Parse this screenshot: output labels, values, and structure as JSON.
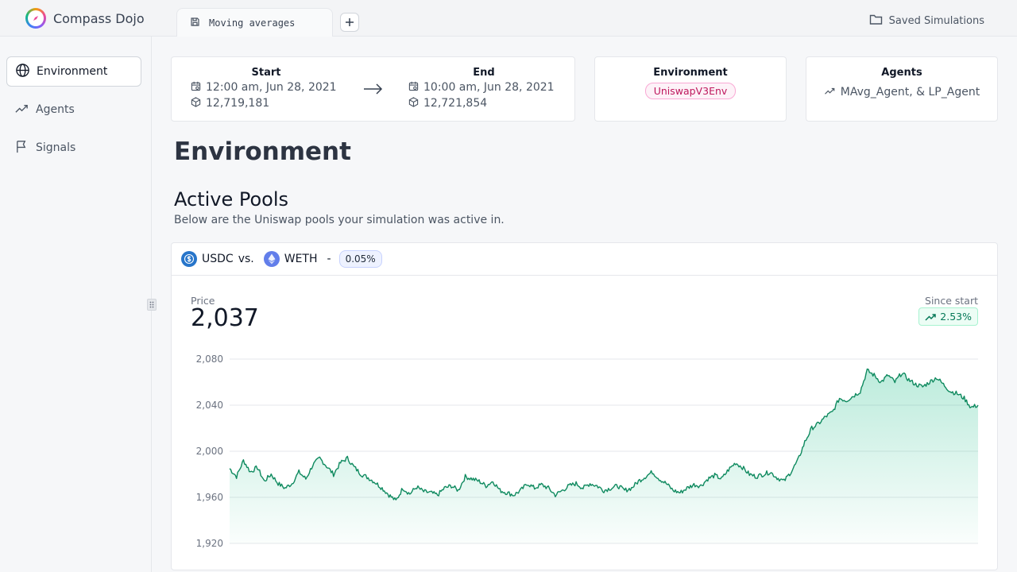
{
  "app": {
    "name": "Compass Dojo"
  },
  "tabs": [
    {
      "label": "Moving averages"
    }
  ],
  "header": {
    "saved_label": "Saved Simulations"
  },
  "sidebar": {
    "items": [
      {
        "label": "Environment",
        "icon": "globe-icon",
        "active": true
      },
      {
        "label": "Agents",
        "icon": "trend-icon",
        "active": false
      },
      {
        "label": "Signals",
        "icon": "flag-icon",
        "active": false
      }
    ]
  },
  "summary": {
    "start": {
      "title": "Start",
      "time": "12:00 am, Jun 28, 2021",
      "block": "12,719,181"
    },
    "end": {
      "title": "End",
      "time": "10:00 am, Jun 28, 2021",
      "block": "12,721,854"
    },
    "environment": {
      "title": "Environment",
      "value": "UniswapV3Env"
    },
    "agents": {
      "title": "Agents",
      "value": "MAvg_Agent, & LP_Agent"
    }
  },
  "page": {
    "title": "Environment",
    "section_title": "Active Pools",
    "section_subtitle": "Below are the Uniswap pools your simulation was active in."
  },
  "pool": {
    "token0": "USDC",
    "vs": "vs.",
    "token1": "WETH",
    "dash": "-",
    "fee": "0.05%",
    "price_label": "Price",
    "price_value": "2,037",
    "since_label": "Since start",
    "since_value": "2.53%"
  },
  "colors": {
    "accent": "#0f8a5f",
    "fill": "#10b981"
  },
  "chart_data": {
    "type": "area",
    "title": "",
    "xlabel": "",
    "ylabel": "",
    "ylim": [
      1920,
      2080
    ],
    "yticks": [
      2080,
      2040,
      2000,
      1960,
      1920
    ],
    "ytick_labels": [
      "2,080",
      "2,040",
      "2,000",
      "1,960",
      "1,920"
    ],
    "grid": true,
    "series": [
      {
        "values": [
          1985,
          1978,
          1992,
          1982,
          1986,
          1974,
          1980,
          1972,
          1968,
          1972,
          1982,
          1976,
          1988,
          1994,
          1987,
          1980,
          1990,
          1994,
          1986,
          1980,
          1977,
          1973,
          1968,
          1962,
          1957,
          1968,
          1963,
          1969,
          1965,
          1964,
          1962,
          1968,
          1970,
          1966,
          1978,
          1976,
          1974,
          1970,
          1974,
          1966,
          1964,
          1962,
          1966,
          1972,
          1968,
          1971,
          1968,
          1962,
          1966,
          1970,
          1972,
          1968,
          1972,
          1970,
          1966,
          1968,
          1970,
          1966,
          1968,
          1974,
          1978,
          1982,
          1976,
          1972,
          1966,
          1964,
          1968,
          1971,
          1970,
          1976,
          1979,
          1976,
          1984,
          1990,
          1986,
          1980,
          1978,
          1980,
          1982,
          1977,
          1974,
          1982,
          1992,
          2008,
          2020,
          2024,
          2030,
          2034,
          2046,
          2044,
          2048,
          2052,
          2070,
          2066,
          2060,
          2066,
          2060,
          2068,
          2062,
          2058,
          2056,
          2060,
          2064,
          2058,
          2052,
          2050,
          2046,
          2038,
          2040
        ]
      }
    ]
  }
}
